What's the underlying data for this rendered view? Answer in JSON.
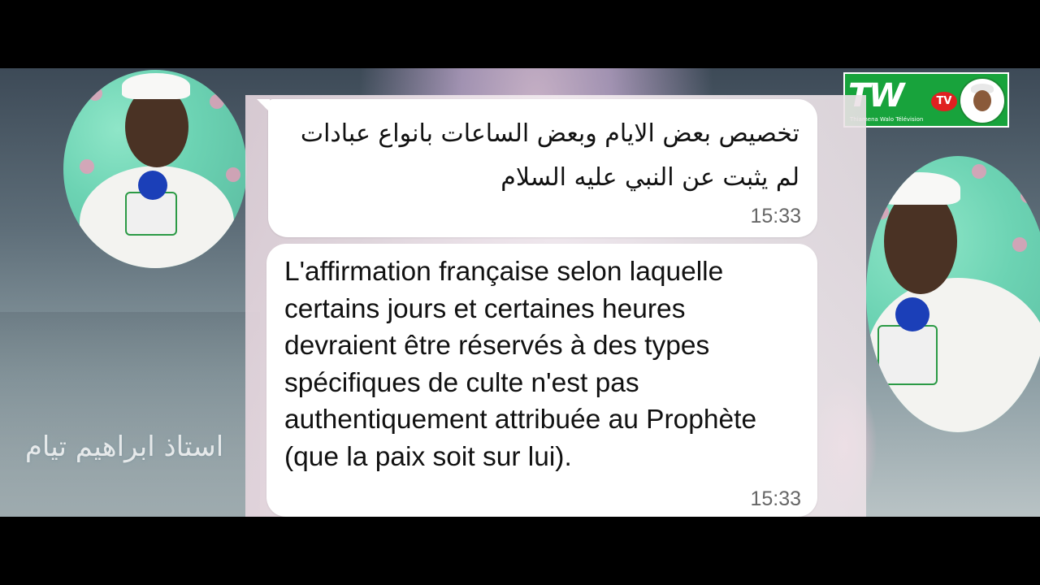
{
  "caption": {
    "speaker_arabic": "استاذ ابراهيم تيام"
  },
  "logo": {
    "brand": "TW",
    "tv_badge": "TV",
    "subtitle": "Thiamena Walo Télévision"
  },
  "messages": [
    {
      "text": "تخصيص بعض الايام وبعض الساعات بانواع عبادات لم يثبت عن النبي عليه السلام",
      "time": "15:33"
    },
    {
      "text": "L'affirmation française selon laquelle certains jours et certaines heures devraient être réservés à des types spécifiques de culte n'est pas authentiquement attribuée au Prophète (que la paix soit sur lui).",
      "time": "15:33"
    }
  ]
}
